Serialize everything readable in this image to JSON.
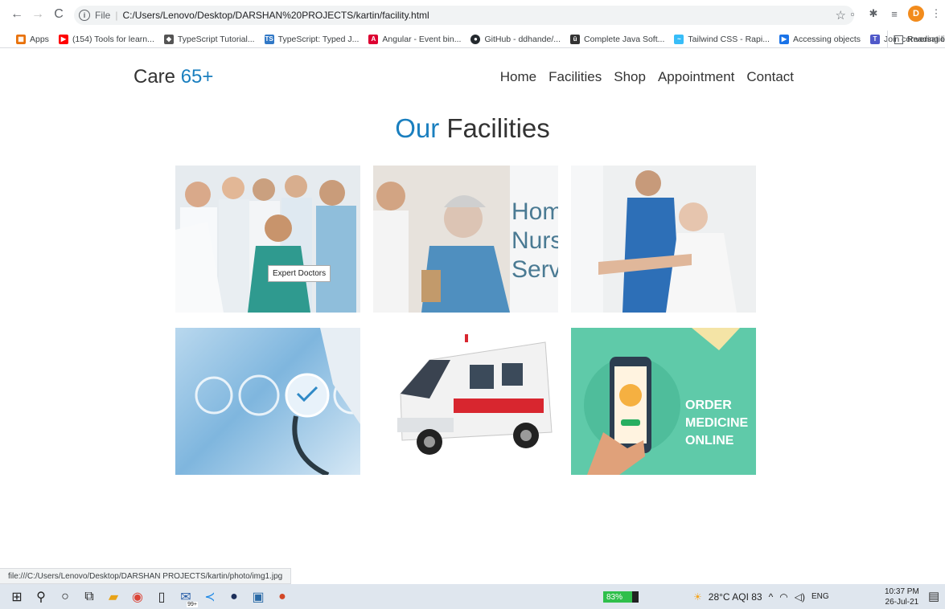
{
  "browser": {
    "file_label": "File",
    "url": "C:/Users/Lenovo/Desktop/DARSHAN%20PROJECTS/kartin/facility.html",
    "profile_initial": "D",
    "bookmarks": [
      {
        "label": "Apps",
        "color": "#e8710a"
      },
      {
        "label": "(154) Tools for learn...",
        "color": "#ff0000"
      },
      {
        "label": "TypeScript Tutorial...",
        "color": "#555555"
      },
      {
        "label": "TypeScript: Typed J...",
        "color": "#3178c6"
      },
      {
        "label": "Angular - Event bin...",
        "color": "#dd0031"
      },
      {
        "label": "GitHub - ddhande/...",
        "color": "#24292e"
      },
      {
        "label": "Complete Java Soft...",
        "color": "#333333"
      },
      {
        "label": "Tailwind CSS - Rapi...",
        "color": "#38bdf8"
      },
      {
        "label": "Accessing objects",
        "color": "#1a73e8"
      },
      {
        "label": "Join conversation",
        "color": "#5059c9"
      }
    ],
    "reading_list": "Reading list"
  },
  "site": {
    "logo_main": "Care ",
    "logo_accent": "65+",
    "nav": [
      "Home",
      "Facilities",
      "Shop",
      "Appointment",
      "Contact"
    ],
    "heading_accent": "Our",
    "heading_main": " Facilities",
    "tiles": {
      "tooltip": "Expert Doctors",
      "nurse_lines": [
        "Hom",
        "Nurs",
        "Serv"
      ],
      "order_lines": [
        "ORDER",
        "MEDICINE",
        "ONLINE"
      ]
    },
    "status_url": "file:///C:/Users/Lenovo/Desktop/DARSHAN PROJECTS/kartin/photo/img1.jpg"
  },
  "taskbar": {
    "battery": "83%",
    "weather": "28°C AQI 83",
    "lang": "ENG",
    "time": "10:37 PM",
    "date": "26-Jul-21",
    "badge": "99+"
  }
}
